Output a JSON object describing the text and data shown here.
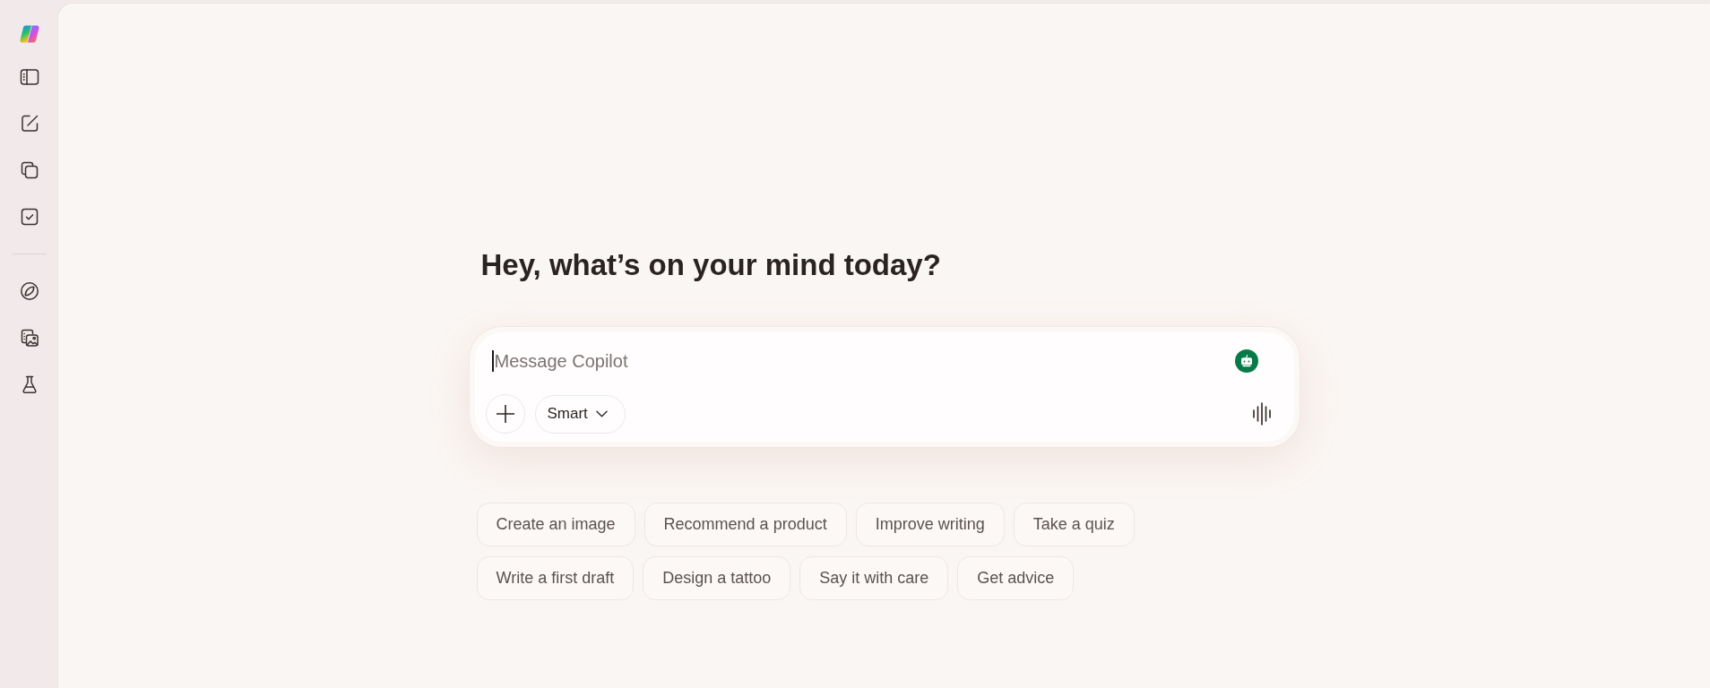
{
  "heading": "Hey, what’s on your mind today?",
  "composer": {
    "placeholder": "Message Copilot",
    "focused": true,
    "mode_button": "Smart"
  },
  "suggestion_rows": [
    {
      "chips": [
        "Create an image",
        "Recommend a product",
        "Improve writing",
        "Take a quiz"
      ]
    },
    {
      "chips": [
        "Write a first draft",
        "Design a tattoo",
        "Say it with care",
        "Get advice"
      ]
    }
  ]
}
